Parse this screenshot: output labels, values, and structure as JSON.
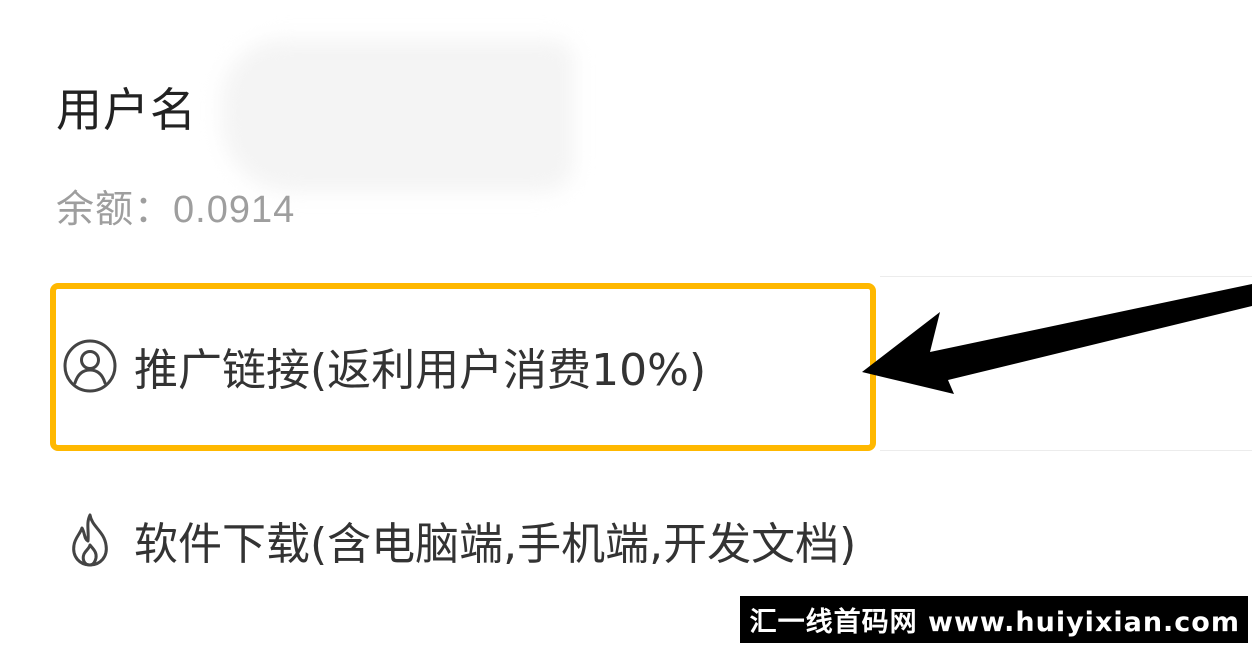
{
  "account": {
    "username_label": "用户名",
    "balance_label": "余额：",
    "balance_value": "0.0914"
  },
  "menu": {
    "items": [
      {
        "label": "推广链接(返利用户消费10%)",
        "icon": "user-circle-icon"
      },
      {
        "label": "软件下载(含电脑端,手机端,开发文档)",
        "icon": "fire-icon"
      }
    ]
  },
  "annotation": {
    "highlight_color": "#ffb800",
    "arrow_color": "#000000"
  },
  "watermark": {
    "text": "汇一线首码网 www.huiyixian.com"
  }
}
